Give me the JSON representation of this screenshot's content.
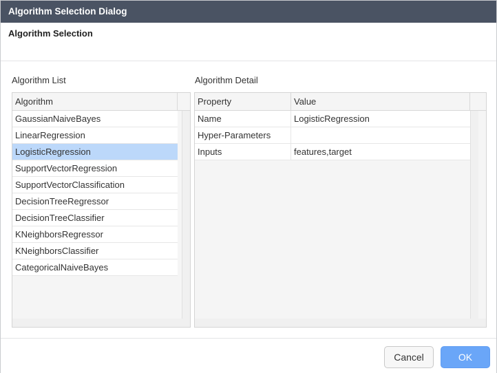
{
  "window": {
    "title": "Algorithm Selection Dialog"
  },
  "header": {
    "title": "Algorithm Selection"
  },
  "algorithm_list": {
    "label": "Algorithm List",
    "column_header": "Algorithm",
    "selected_index": 2,
    "items": [
      "GaussianNaiveBayes",
      "LinearRegression",
      "LogisticRegression",
      "SupportVectorRegression",
      "SupportVectorClassification",
      "DecisionTreeRegressor",
      "DecisionTreeClassifier",
      "KNeighborsRegressor",
      "KNeighborsClassifier",
      "CategoricalNaiveBayes"
    ]
  },
  "algorithm_detail": {
    "label": "Algorithm Detail",
    "columns": [
      "Property",
      "Value"
    ],
    "rows": [
      {
        "property": "Name",
        "value": "LogisticRegression"
      },
      {
        "property": "Hyper-Parameters",
        "value": ""
      },
      {
        "property": "Inputs",
        "value": "features,target"
      }
    ]
  },
  "footer": {
    "cancel_label": "Cancel",
    "ok_label": "OK"
  },
  "colors": {
    "titlebar": "#4a5363",
    "selection": "#bcd8fa",
    "ok_button": "#6aa6f8"
  }
}
